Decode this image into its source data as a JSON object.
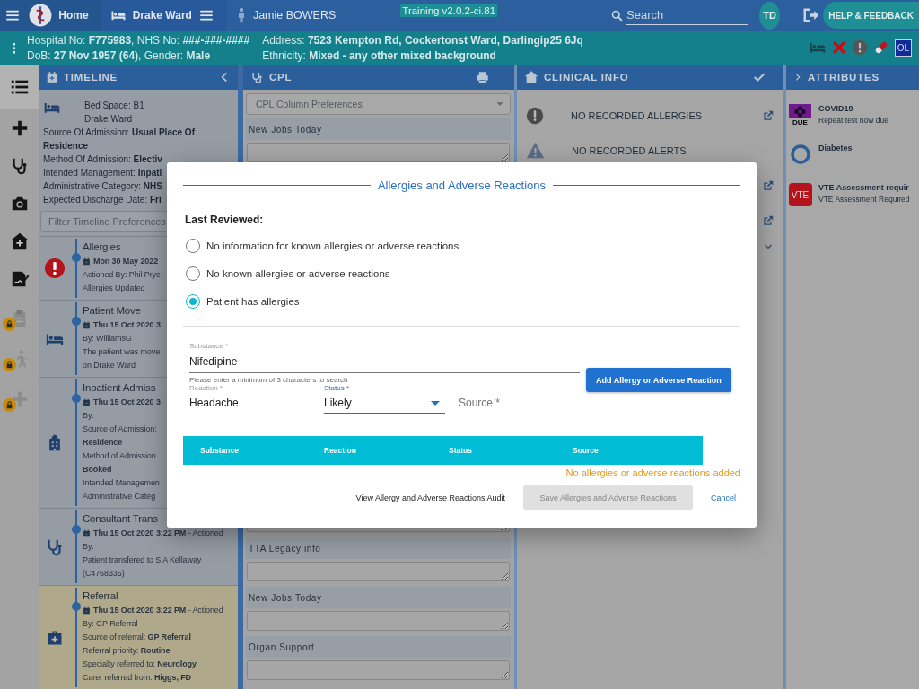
{
  "topbar": {
    "crumbs": [
      {
        "kind": "home",
        "label": "Home"
      },
      {
        "kind": "ward",
        "label": "Drake Ward"
      },
      {
        "kind": "patient",
        "label": "Jamie BOWERS"
      }
    ],
    "environment": "Training v2.0.2-ci.81",
    "search": {
      "placeholder": "Search"
    },
    "avatar": "TD",
    "help_button": "HELP & FEEDBACK"
  },
  "patient_banner": {
    "details": [
      "Hospital No: **F775983**, NHS No: **###-###-####**",
      "DoB: **27 Nov 1957 (64)**, Gender: **Male**"
    ],
    "address": [
      "Address: **7523 Kempton Rd, Cockertonst Ward, Darlingip25 6Jq**",
      "Ethnicity: **Mixed - any other mixed background**"
    ],
    "flags": [
      {
        "kind": "bed"
      },
      {
        "kind": "cross"
      },
      {
        "kind": "alert"
      },
      {
        "kind": "pill"
      },
      {
        "kind": "badge",
        "label": "OL"
      }
    ]
  },
  "sidebar": {
    "items": [
      {
        "kind": "list",
        "selected": true,
        "locked": false
      },
      {
        "kind": "plus",
        "selected": false,
        "locked": false
      },
      {
        "kind": "stethoscope",
        "selected": false,
        "locked": false
      },
      {
        "kind": "camera",
        "selected": false,
        "locked": false
      },
      {
        "kind": "house",
        "selected": false,
        "locked": false
      },
      {
        "kind": "sign",
        "selected": false,
        "locked": false
      },
      {
        "kind": "clipboard",
        "selected": false,
        "locked": true
      },
      {
        "kind": "walker",
        "selected": false,
        "locked": true
      },
      {
        "kind": "plus",
        "selected": false,
        "locked": true
      }
    ]
  },
  "timeline": {
    "title": "TIMELINE",
    "summary": {
      "lines": [
        "Bed Space: B1",
        "Drake Ward"
      ],
      "details": [
        "Source Of Admission: **Usual Place Of Residence**",
        "Method Of Admission: **Electiv**",
        "Intended Management: **Inpati**",
        "Administrative Category: **NHS**",
        "Expected Discharge Date: **Fri**"
      ]
    },
    "filter": {
      "placeholder": "Filter Timeline Preferences"
    },
    "events": [
      {
        "kind": "alert",
        "title": "Allergies",
        "date": "**Mon 30 May 2022**",
        "lines": [
          "Actioned By: Phil Pryc",
          "Allergies Updated"
        ],
        "selected": false
      },
      {
        "kind": "bed",
        "title": "Patient Move",
        "date": "**Thu 15 Oct 2020 3**",
        "lines": [
          "By: WilliamsG",
          "The patient was move",
          "on Drake Ward"
        ],
        "selected": false
      },
      {
        "kind": "hospital",
        "title": "Inpatient Admiss",
        "date": "**Thu 15 Oct 2020 3**",
        "lines": [
          "By:",
          "Source of Admission:",
          "**Residence**",
          "Method of Admission",
          "**Booked**",
          "Intended Managemen",
          "Administrative Categ"
        ],
        "selected": false
      },
      {
        "kind": "stethoscope",
        "title": "Consultant Trans",
        "date": "**Thu 15 Oct 2020 3:22 PM** - Actioned",
        "lines": [
          "By:",
          "Patient transfered to S A Kellaway",
          "(C4768335)"
        ],
        "selected": false
      },
      {
        "kind": "firstaid",
        "title": "Referral",
        "date": "**Thu 15 Oct 2020 3:22 PM** - Actioned",
        "lines": [
          "By: GP Referral",
          "Source of referral: **GP Referral**",
          "Referral priority: **Routine**",
          "Specialty referred to: **Neurology**",
          "Carer referred from: **Higgs, FD**"
        ],
        "selected": true
      }
    ]
  },
  "cpl": {
    "title": "CPL",
    "preferences": {
      "placeholder": "CPL Column Preferences"
    },
    "sections_top": [
      {
        "label": "New Jobs Today"
      }
    ],
    "sections_bottom": [
      {
        "label": "TTA Legacy info"
      },
      {
        "label": "New Jobs Today"
      },
      {
        "label": "Organ Support"
      }
    ]
  },
  "clinical_info": {
    "title": "CLINICAL INFO",
    "rows": [
      {
        "kind": "allergy",
        "label": "NO RECORDED ALLERGIES",
        "link": true
      },
      {
        "kind": "alert",
        "label": "NO RECORDED ALERTS",
        "link": false
      },
      {
        "kind": "hidden",
        "link": true
      },
      {
        "kind": "hidden",
        "link": true
      }
    ]
  },
  "attributes": {
    "title": "ATTRIBUTES",
    "items": [
      {
        "kind": "covid",
        "icon_text": "DUE",
        "title": "COVID19",
        "subtitle": "Repeat test now due"
      },
      {
        "kind": "ring",
        "title": "Diabetes"
      },
      {
        "kind": "vte",
        "icon_text": "VTE",
        "title": "VTE Assessment requir",
        "subtitle": "VTE Assessment Required"
      }
    ]
  },
  "modal": {
    "title": "Allergies and Adverse Reactions",
    "reviewed_label": "Last Reviewed:",
    "options": [
      {
        "label": "No information for known allergies or adverse reactions",
        "selected": false
      },
      {
        "label": "No known allergies or adverse reactions",
        "selected": false
      },
      {
        "label": "Patient has allergies",
        "selected": true
      }
    ],
    "substance": {
      "label": "Substance *",
      "value": "Nifedipine",
      "hint": "Please enter a minimum of 3 characters to search"
    },
    "fields": [
      {
        "kind": "text",
        "label": "Reaction *",
        "value": "Headache",
        "focused": false
      },
      {
        "kind": "select",
        "label": "Status *",
        "value": "Likely",
        "focused": true
      },
      {
        "kind": "text",
        "placeholder": "Source *",
        "focused": false
      }
    ],
    "add_button": "Add Allergy or Adverse Reaction",
    "table": {
      "columns": [
        "Substance",
        "Reaction",
        "Status",
        "Source"
      ]
    },
    "empty_message": "No allergies or adverse reactions added",
    "actions": [
      {
        "kind": "link",
        "label": "View Allergy and Adverse Reactions Audit"
      },
      {
        "kind": "primary",
        "label": "Save Allergies and Adverse Reactions",
        "disabled": true
      },
      {
        "kind": "text",
        "label": "Cancel"
      }
    ]
  }
}
